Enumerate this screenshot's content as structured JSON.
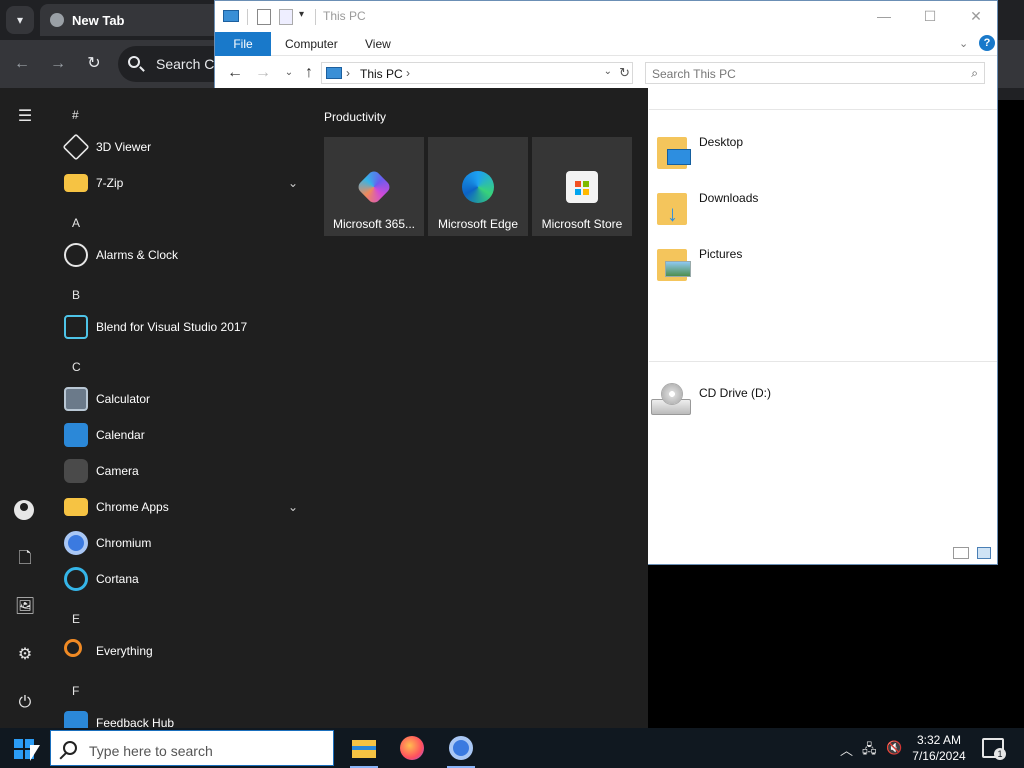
{
  "chrome": {
    "tab_title": "New Tab",
    "search_text": "Search Co"
  },
  "explorer": {
    "title": "This PC",
    "ribbon": {
      "file": "File",
      "computer": "Computer",
      "view": "View",
      "help": "?"
    },
    "address": "This PC",
    "search_placeholder": "Search This PC",
    "folders": [
      {
        "label": "Desktop"
      },
      {
        "label": "Downloads"
      },
      {
        "label": "Pictures"
      }
    ],
    "drive": {
      "label": "CD Drive (D:)"
    }
  },
  "start_menu": {
    "letters": [
      "#",
      "A",
      "B",
      "C",
      "E",
      "F"
    ],
    "apps": [
      {
        "label": "3D Viewer"
      },
      {
        "label": "7-Zip"
      },
      {
        "label": "Alarms & Clock"
      },
      {
        "label": "Blend for Visual Studio 2017"
      },
      {
        "label": "Calculator"
      },
      {
        "label": "Calendar"
      },
      {
        "label": "Camera"
      },
      {
        "label": "Chrome Apps"
      },
      {
        "label": "Chromium"
      },
      {
        "label": "Cortana"
      },
      {
        "label": "Everything"
      },
      {
        "label": "Feedback Hub"
      }
    ],
    "tiles_header": "Productivity",
    "tiles": [
      {
        "label": "Microsoft 365..."
      },
      {
        "label": "Microsoft Edge"
      },
      {
        "label": "Microsoft Store"
      }
    ]
  },
  "taskbar": {
    "search_placeholder": "Type here to search",
    "time": "3:32 AM",
    "date": "7/16/2024",
    "notification_count": "1"
  },
  "colors": {
    "accent": "#1979ca",
    "start_bg": "#1f1f1f",
    "taskbar_bg": "#101820"
  }
}
